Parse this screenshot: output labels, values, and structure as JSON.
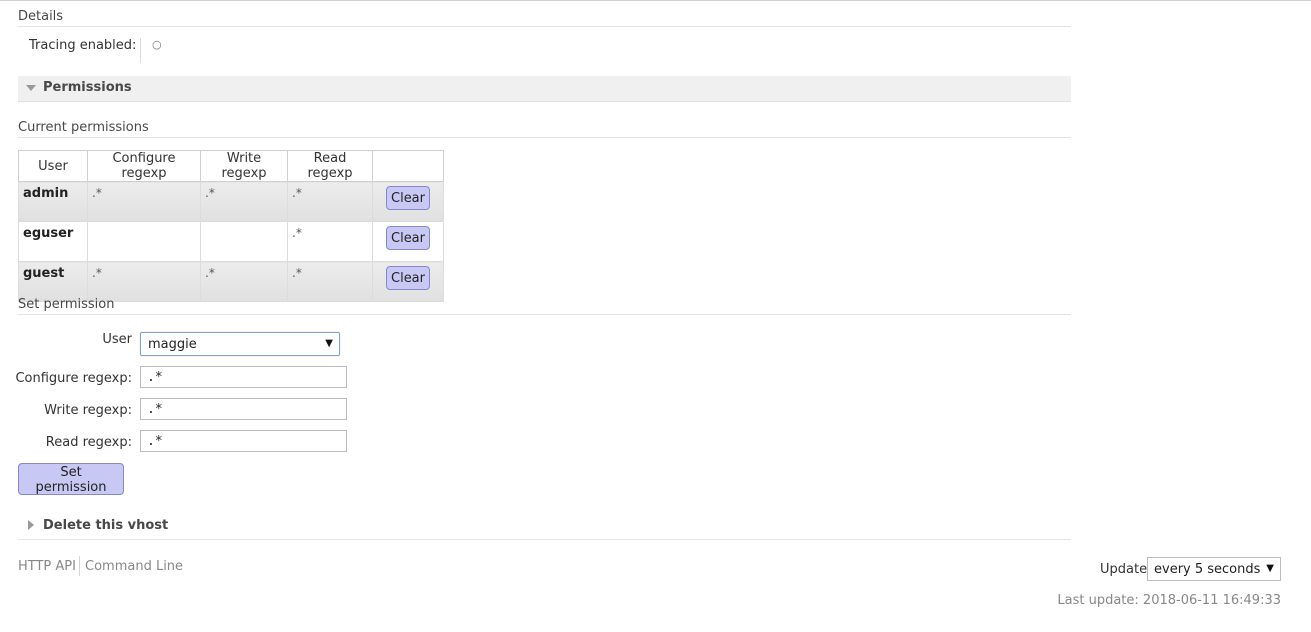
{
  "details": {
    "title": "Details",
    "tracing_label": "Tracing enabled:",
    "tracing_value": "○"
  },
  "permissions_section": {
    "title": "Permissions",
    "current_title": "Current permissions",
    "table": {
      "headers": [
        "User",
        "Configure regexp",
        "Write regexp",
        "Read regexp",
        ""
      ],
      "rows": [
        {
          "user": "admin",
          "configure": ".*",
          "write": ".*",
          "read": ".*",
          "action": "Clear"
        },
        {
          "user": "eguser",
          "configure": "",
          "write": "",
          "read": ".*",
          "action": "Clear"
        },
        {
          "user": "guest",
          "configure": ".*",
          "write": ".*",
          "read": ".*",
          "action": "Clear"
        }
      ]
    }
  },
  "set_permission": {
    "title": "Set permission",
    "user_label": "User",
    "user_value": "maggie",
    "configure_label": "Configure regexp:",
    "configure_value": ".*",
    "write_label": "Write regexp:",
    "write_value": ".*",
    "read_label": "Read regexp:",
    "read_value": ".*",
    "submit_label": "Set permission"
  },
  "delete_section": {
    "title": "Delete this vhost"
  },
  "footer": {
    "links": [
      "HTTP API",
      "Command Line"
    ],
    "update_label": "Update",
    "update_value": "every 5 seconds",
    "last_update": "Last update: 2018-06-11 16:49:33"
  }
}
